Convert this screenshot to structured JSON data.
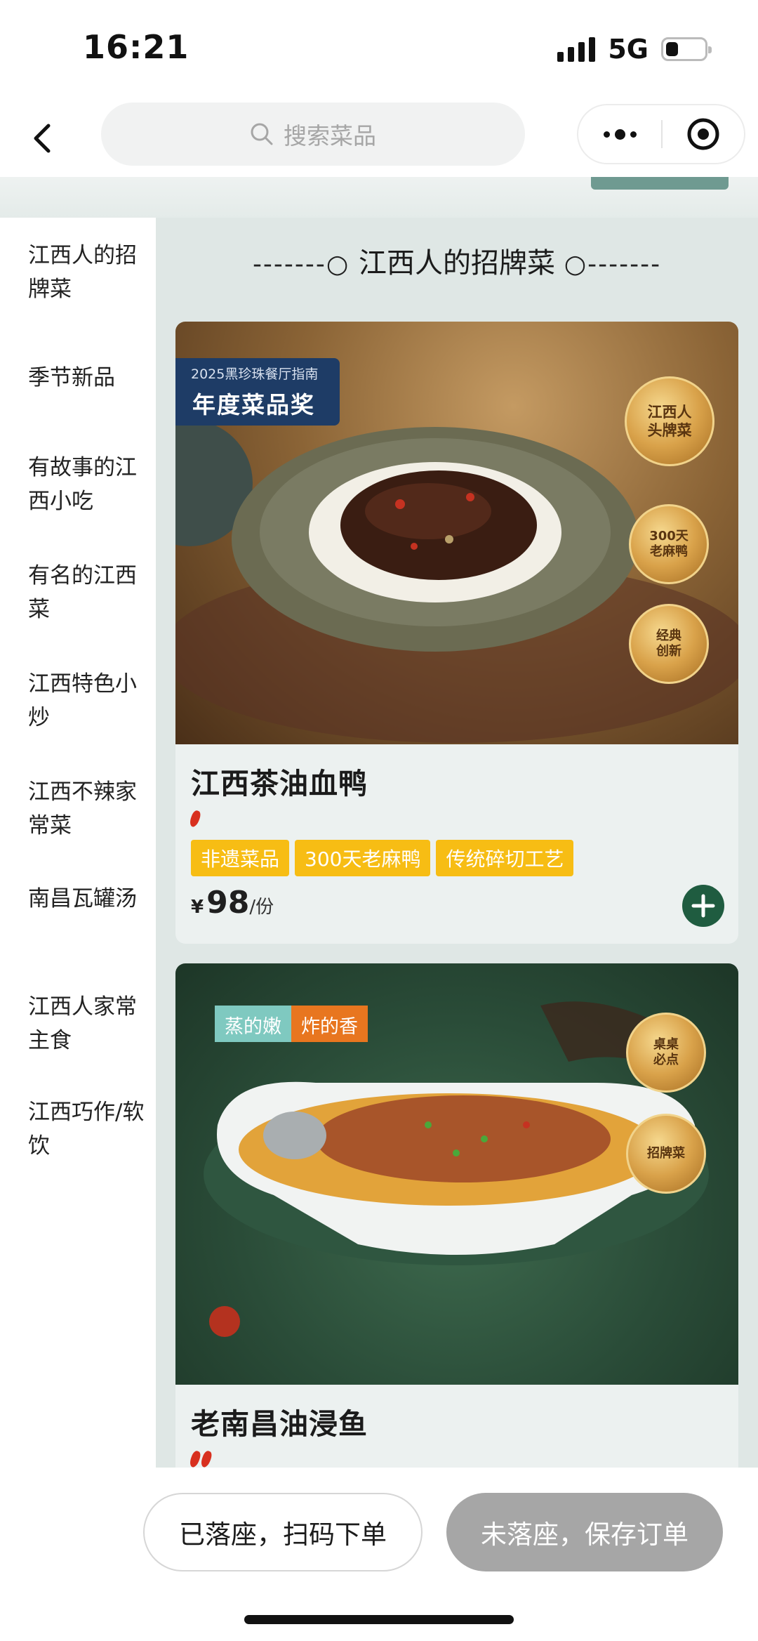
{
  "status_bar": {
    "time": "16:21",
    "network": "5G"
  },
  "nav": {
    "search_placeholder": "搜索菜品",
    "back_icon": "chevron-left-icon",
    "more_icon": "more-dots-icon",
    "mini_app_icon": "target-circle-icon"
  },
  "sidebar": {
    "items": [
      {
        "label": "江西人的招牌菜"
      },
      {
        "label": "季节新品"
      },
      {
        "label": "有故事的江西小吃"
      },
      {
        "label": "有名的江西菜"
      },
      {
        "label": "江西特色小炒"
      },
      {
        "label": "江西不辣家常菜"
      },
      {
        "label": "南昌瓦罐汤"
      },
      {
        "label": "江西人家常主食"
      },
      {
        "label": "江西巧作/软饮"
      }
    ]
  },
  "main": {
    "section_title": "江西人的招牌菜",
    "section_title_left": "-------○",
    "section_title_right": "○-------",
    "dishes": [
      {
        "name": "江西茶油血鸭",
        "award_line1": "2025黑珍珠餐厅指南",
        "award_line2": "年度菜品奖",
        "medals": [
          "江西人头牌菜",
          "300天老麻鸭",
          "经典创新"
        ],
        "spicy_level": 1,
        "tags": [
          "非遗菜品",
          "300天老麻鸭",
          "传统碎切工艺"
        ],
        "price_symbol": "¥",
        "price": "98",
        "unit": "/份"
      },
      {
        "name": "老南昌油浸鱼",
        "photo_tag_left": "蒸的嫩",
        "photo_tag_right": "炸的香",
        "medals": [
          "桌桌必点",
          "招牌菜"
        ],
        "spicy_level": 2
      }
    ]
  },
  "bottom": {
    "seated_button": "已落座，扫码下单",
    "save_button": "未落座，保存订单"
  },
  "colors": {
    "accent_green": "#1f5c40",
    "tag_yellow": "#f7bd14",
    "save_grey": "#a6a6a6"
  }
}
